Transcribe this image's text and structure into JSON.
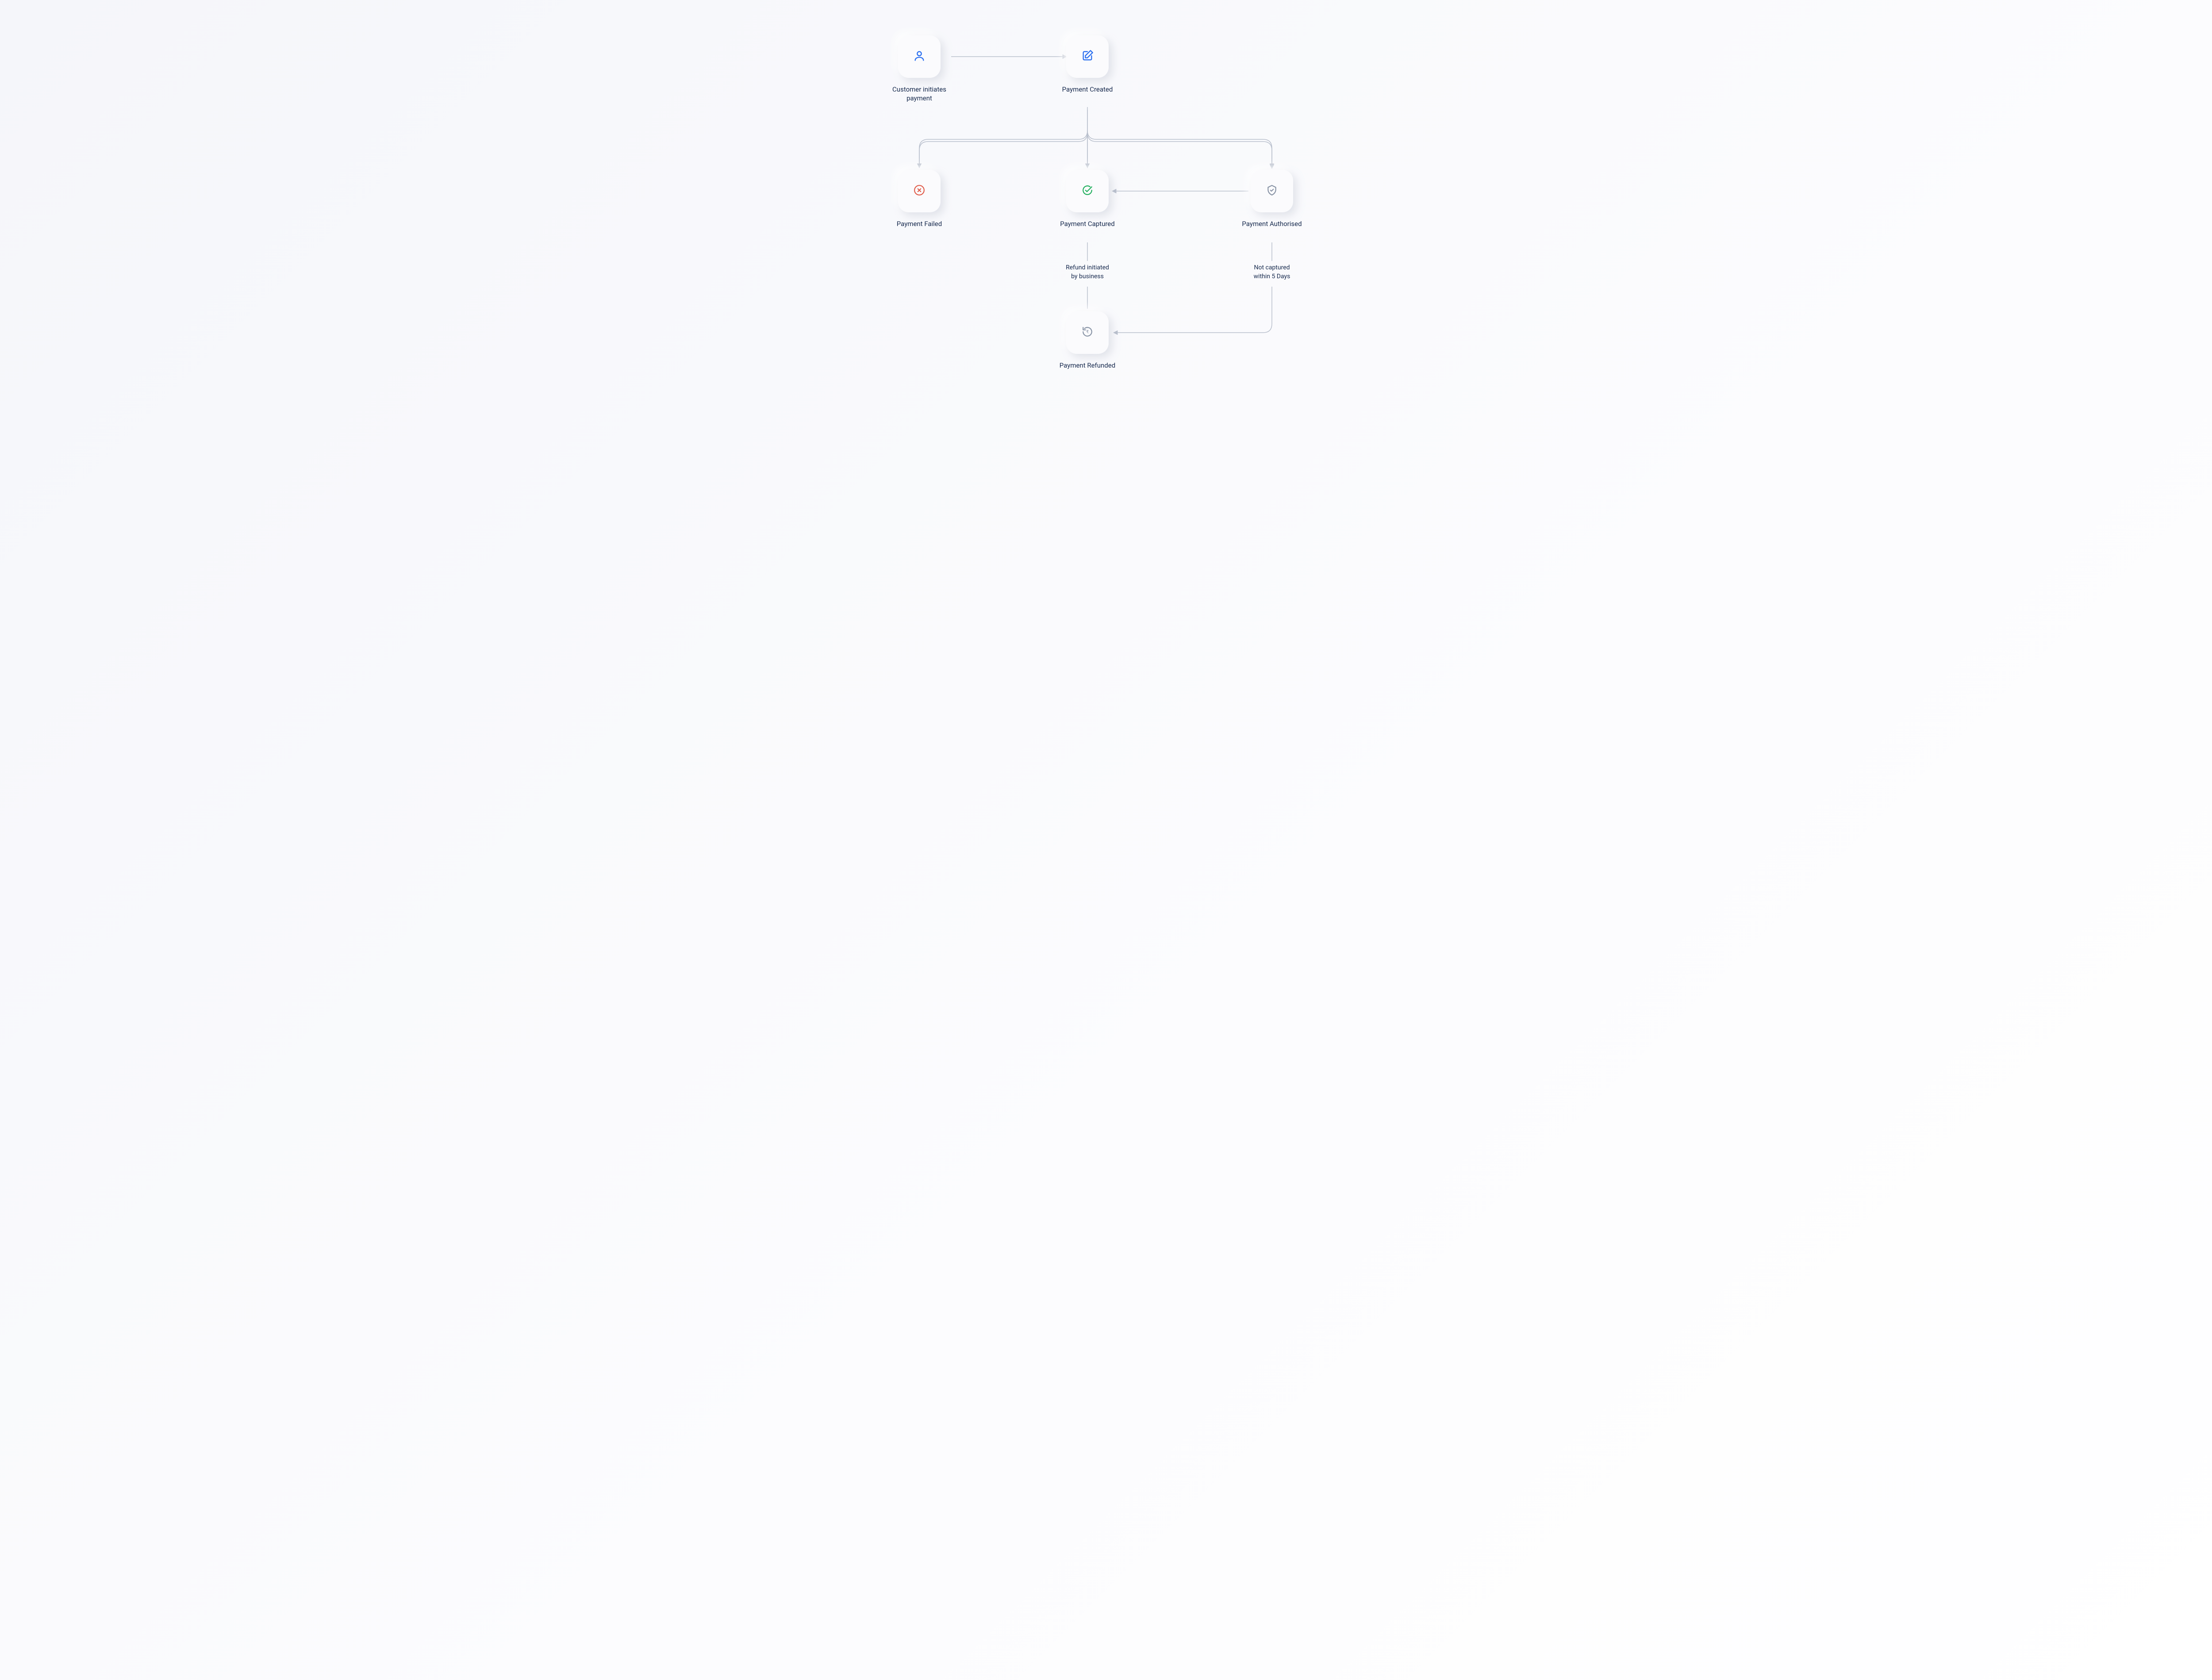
{
  "nodes": {
    "initiate": {
      "label": "Customer initiates\npayment"
    },
    "created": {
      "label": "Payment Created"
    },
    "failed": {
      "label": "Payment Failed"
    },
    "captured": {
      "label": "Payment Captured"
    },
    "authorised": {
      "label": "Payment Authorised"
    },
    "refunded": {
      "label": "Payment Refunded"
    }
  },
  "captions": {
    "refund_initiated": "Refund initiated\nby business",
    "not_captured": "Not captured\nwithin 5 Days"
  }
}
